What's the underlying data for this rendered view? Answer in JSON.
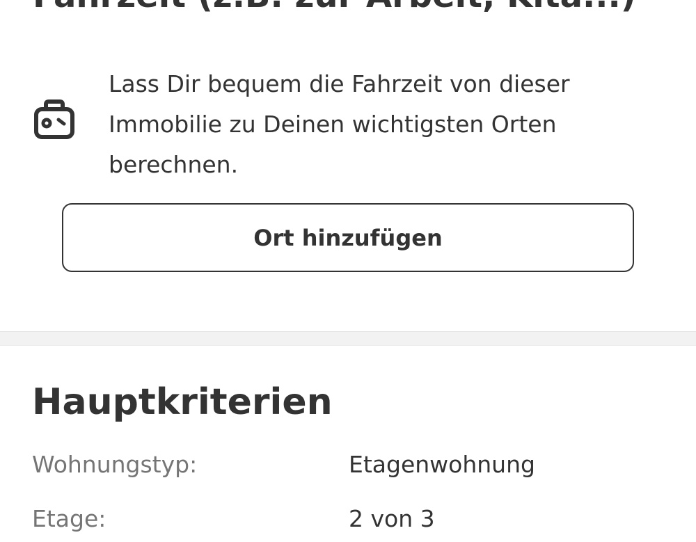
{
  "commute": {
    "title": "Fahrzeit (z.B. zur Arbeit, Kita...)",
    "description": "Lass Dir bequem die Fahrzeit von dieser Immobilie zu Deinen wichtigsten Orten berechnen.",
    "button_label": "Ort hinzufügen",
    "icon": "commute-icon"
  },
  "main_criteria": {
    "heading": "Hauptkriterien",
    "rows": [
      {
        "label": "Wohnungstyp:",
        "value": "Etagenwohnung"
      },
      {
        "label": "Etage:",
        "value": "2 von 3"
      }
    ]
  }
}
